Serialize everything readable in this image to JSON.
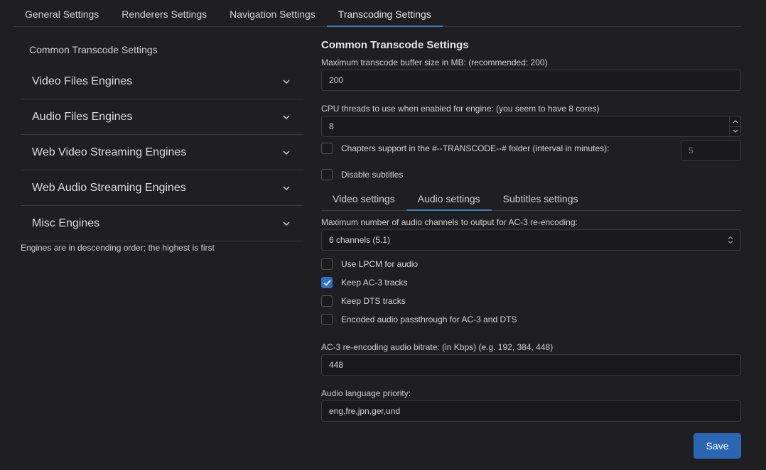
{
  "top_tabs": [
    {
      "label": "General Settings"
    },
    {
      "label": "Renderers Settings"
    },
    {
      "label": "Navigation Settings"
    },
    {
      "label": "Transcoding Settings"
    }
  ],
  "left": {
    "header": "Common Transcode Settings",
    "items": [
      {
        "label": "Video Files Engines"
      },
      {
        "label": "Audio Files Engines"
      },
      {
        "label": "Web Video Streaming Engines"
      },
      {
        "label": "Web Audio Streaming Engines"
      },
      {
        "label": "Misc Engines"
      }
    ],
    "note": "Engines are in descending order; the highest is first"
  },
  "right": {
    "title": "Common Transcode Settings",
    "buffer": {
      "label": "Maximum transcode buffer size in MB: (recommended: 200)",
      "value": "200"
    },
    "threads": {
      "label": "CPU threads to use when enabled for engine: (you seem to have 8 cores)",
      "value": "8"
    },
    "chapters": {
      "label": "Chapters support in the #--TRANSCODE--# folder (interval in minutes):",
      "checked": false,
      "interval_value": "5"
    },
    "disable_subtitles": {
      "label": "Disable subtitles",
      "checked": false
    },
    "sub_tabs": [
      {
        "label": "Video settings"
      },
      {
        "label": "Audio settings"
      },
      {
        "label": "Subtitles settings"
      }
    ],
    "audio": {
      "channels_label": "Maximum number of audio channels to output for AC-3 re-encoding:",
      "channels_value": "6 channels (5.1)",
      "checks": [
        {
          "label": "Use LPCM for audio",
          "checked": false
        },
        {
          "label": "Keep AC-3 tracks",
          "checked": true
        },
        {
          "label": "Keep DTS tracks",
          "checked": false
        },
        {
          "label": "Encoded audio passthrough for AC-3 and DTS",
          "checked": false
        }
      ],
      "bitrate_label": "AC-3 re-encoding audio bitrate: (in Kbps) (e.g. 192, 384, 448)",
      "bitrate_value": "448",
      "language_label": "Audio language priority:",
      "language_value": "eng,fre,jpn,ger,und"
    }
  },
  "save_label": "Save",
  "colors": {
    "accent": "#3f7bbf",
    "button": "#2a66b4",
    "background": "#1f1f21"
  }
}
